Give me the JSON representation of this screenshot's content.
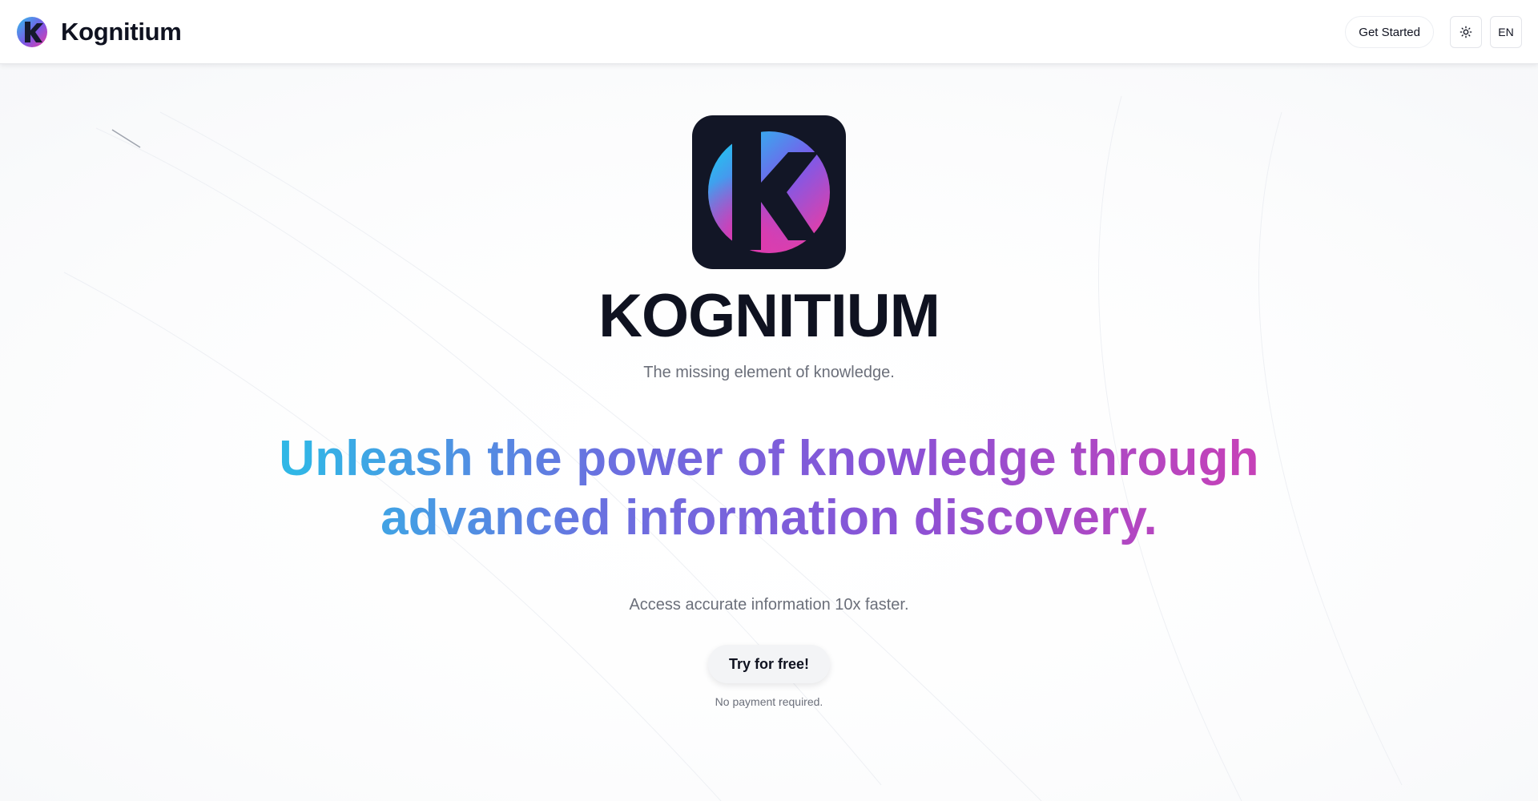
{
  "header": {
    "brand_name": "Kognitium",
    "get_started_label": "Get Started",
    "theme_icon": "sun-icon",
    "language_label": "EN"
  },
  "hero": {
    "title": "KOGNITIUM",
    "tagline": "The missing element of knowledge.",
    "headline_line1": "Unleash the power of knowledge through",
    "headline_line2": "advanced information discovery.",
    "subheadline": "Access accurate information 10x faster.",
    "cta_label": "Try for free!",
    "cta_note": "No payment required."
  },
  "colors": {
    "logo_tile": "#121626",
    "gradient_start": "#30b7e6",
    "gradient_mid": "#8a52d6",
    "gradient_end": "#c541b8",
    "text_primary": "#0f1220",
    "text_muted": "#6b6f7a"
  }
}
